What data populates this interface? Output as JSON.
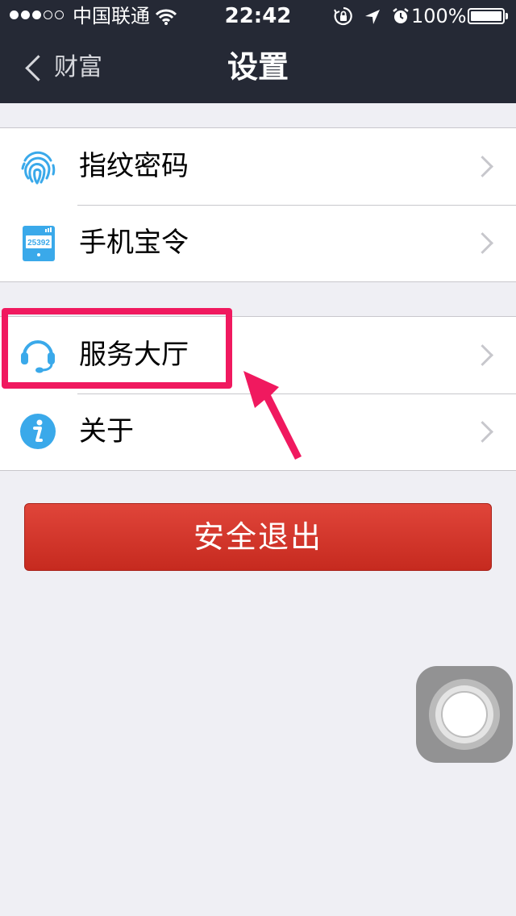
{
  "status_bar": {
    "signal_dots_filled": 3,
    "signal_dots_total": 5,
    "carrier": "中国联通",
    "time": "22:42",
    "battery_percent": "100%",
    "icons": [
      "wifi-icon",
      "rotation-lock-icon",
      "location-icon",
      "alarm-icon",
      "battery-icon"
    ]
  },
  "nav": {
    "back_label": "财富",
    "title": "设置"
  },
  "groups": [
    {
      "rows": [
        {
          "label": "指纹密码",
          "icon": "fingerprint-icon"
        },
        {
          "label": "手机宝令",
          "icon": "phone-token-icon",
          "icon_text": "25392"
        }
      ]
    },
    {
      "rows": [
        {
          "label": "服务大厅",
          "icon": "headset-icon"
        },
        {
          "label": "关于",
          "icon": "info-icon"
        }
      ]
    }
  ],
  "logout": {
    "label": "安全退出"
  },
  "colors": {
    "header_bg": "#252935",
    "page_bg": "#efeff4",
    "icon_blue": "#3aa9ea",
    "logout_red": "#d2352b",
    "annotation_pink": "#f0195f"
  }
}
